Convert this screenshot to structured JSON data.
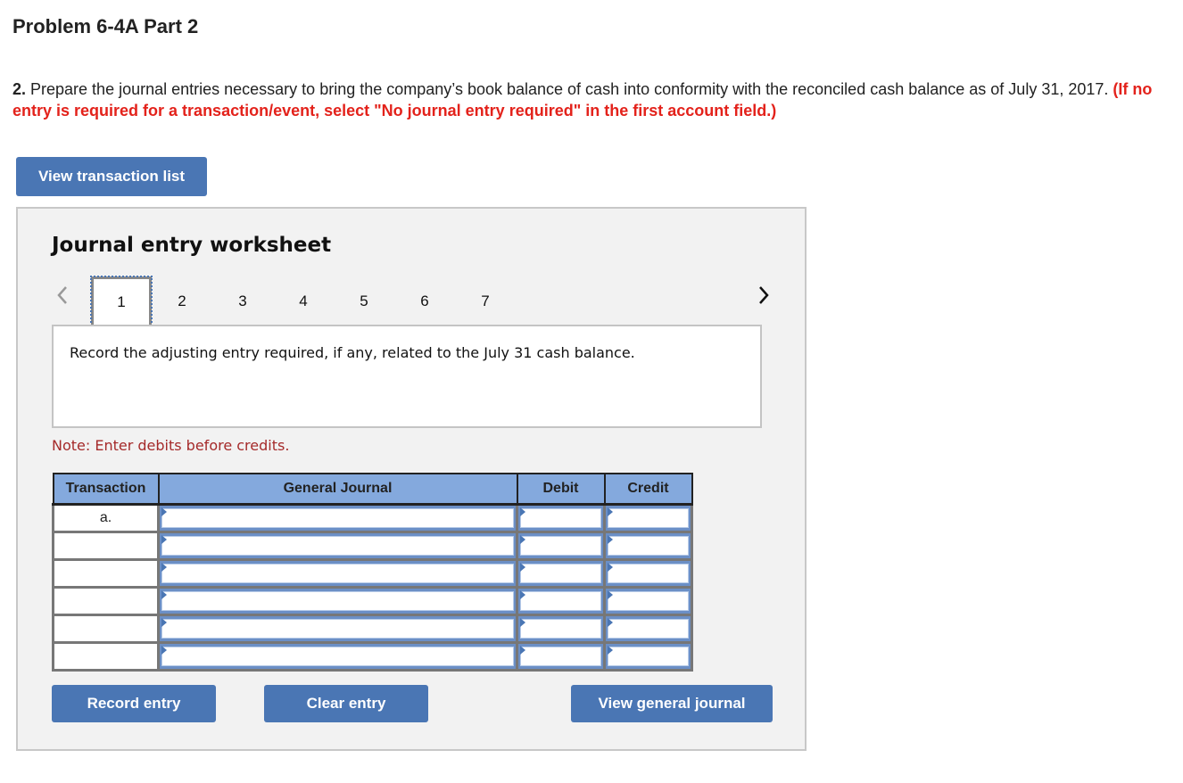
{
  "header": {
    "title": "Problem 6-4A Part 2"
  },
  "instructions": {
    "number": "2.",
    "text": " Prepare the journal entries necessary to bring the company’s book balance of cash into conformity with the reconciled cash balance as of July 31, 2017. ",
    "emphasis": "(If no entry is required for a transaction/event, select \"No journal entry required\" in the first account field.)"
  },
  "buttons": {
    "view_transaction_list": "View transaction list",
    "record_entry": "Record entry",
    "clear_entry": "Clear entry",
    "view_general_journal": "View general journal"
  },
  "worksheet": {
    "title": "Journal entry worksheet",
    "pager": {
      "prev_icon": "chevron-left-icon",
      "next_icon": "chevron-right-icon",
      "pages": [
        "1",
        "2",
        "3",
        "4",
        "5",
        "6",
        "7"
      ],
      "active_page": "1"
    },
    "prompt": "Record the adjusting entry required, if any, related to the July 31 cash balance.",
    "note": "Note: Enter debits before credits.",
    "table": {
      "headers": [
        "Transaction",
        "General Journal",
        "Debit",
        "Credit"
      ],
      "rows": [
        {
          "transaction": "a.",
          "account": "",
          "debit": "",
          "credit": ""
        },
        {
          "transaction": "",
          "account": "",
          "debit": "",
          "credit": ""
        },
        {
          "transaction": "",
          "account": "",
          "debit": "",
          "credit": ""
        },
        {
          "transaction": "",
          "account": "",
          "debit": "",
          "credit": ""
        },
        {
          "transaction": "",
          "account": "",
          "debit": "",
          "credit": ""
        },
        {
          "transaction": "",
          "account": "",
          "debit": "",
          "credit": ""
        }
      ]
    }
  },
  "colors": {
    "accent": "#4a76b4",
    "header_fill": "#84a9dd",
    "warning_red": "#e3221b",
    "note_red": "#a52a2a",
    "panel_bg": "#f2f2f2"
  }
}
